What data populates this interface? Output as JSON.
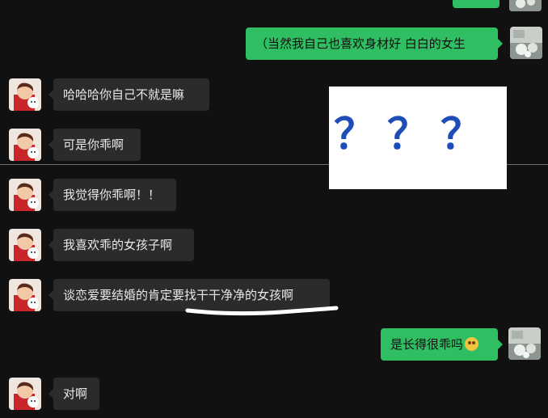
{
  "colors": {
    "background": "#111111",
    "incoming_bubble": "#2b2b2b",
    "outgoing_bubble": "#2fbe62",
    "question_mark": "#1e4db7"
  },
  "messages": [
    {
      "side": "out",
      "text": "（当然我自己也喜欢身材好 白白的女生"
    },
    {
      "side": "in",
      "text": "哈哈哈你自己不就是嘛"
    },
    {
      "side": "in",
      "text": "可是你乖啊"
    },
    {
      "side": "in",
      "text": "我觉得你乖啊！！"
    },
    {
      "side": "in",
      "text": "我喜欢乖的女孩子啊"
    },
    {
      "side": "in",
      "text": "谈恋爱要结婚的肯定要找干干净净的女孩啊"
    },
    {
      "side": "out",
      "text": "是长得很乖吗",
      "emoji": "frowning-face-emoji"
    },
    {
      "side": "in",
      "text": "对啊"
    }
  ],
  "overlay": {
    "question_marks": [
      "？",
      "？",
      "？"
    ]
  },
  "icons": {
    "contact_avatar": "cartoon-avatar-icon",
    "my_avatar": "photo-avatar-icon",
    "annotation": "hand-drawn-underline"
  }
}
